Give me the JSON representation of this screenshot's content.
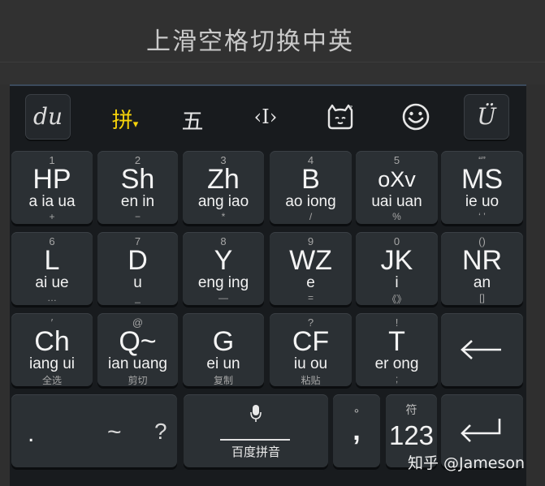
{
  "caption": {
    "title": "上滑空格切换中英"
  },
  "toolbar": {
    "left_logo": "du",
    "pinyin": "拼",
    "pinyin_arrow": "▾",
    "wubi": "五",
    "cursor": "‹I›",
    "cat": "🐱",
    "smile": "☺",
    "right_logo": "Ü"
  },
  "keys": {
    "k1": {
      "num": "1",
      "main": "HP",
      "sub": "a ia ua",
      "bot": "+"
    },
    "k2": {
      "num": "2",
      "main": "Sh",
      "sub": "en in",
      "bot": "−"
    },
    "k3": {
      "num": "3",
      "main": "Zh",
      "sub": "ang iao",
      "bot": "*"
    },
    "k4": {
      "num": "4",
      "main": "B",
      "sub": "ao iong",
      "bot": "/"
    },
    "k5": {
      "num": "5",
      "main": "oXv",
      "sub": "uai uan",
      "bot": "%"
    },
    "k6": {
      "num": "“”",
      "main": "MS",
      "sub": "ie uo",
      "bot": "‘ ’"
    },
    "k7": {
      "num": "6",
      "main": "L",
      "sub": "ai ue",
      "bot": "…"
    },
    "k8": {
      "num": "7",
      "main": "D",
      "sub": "u",
      "bot": "_"
    },
    "k9": {
      "num": "8",
      "main": "Y",
      "sub": "eng ing",
      "bot": "—"
    },
    "k10": {
      "num": "9",
      "main": "WZ",
      "sub": "e",
      "bot": "="
    },
    "k11": {
      "num": "0",
      "main": "JK",
      "sub": "i",
      "bot": "《》"
    },
    "k12": {
      "num": "()",
      "main": "NR",
      "sub": "an",
      "bot": "[]"
    },
    "k13": {
      "num": "′",
      "main": "Ch",
      "sub": "iang ui",
      "bot": "全选"
    },
    "k14": {
      "num": "@",
      "main": "Q~",
      "sub": "ian uang",
      "bot": "剪切"
    },
    "k15": {
      "num": "",
      "main": "G",
      "sub": "ei un",
      "bot": "复制"
    },
    "k16": {
      "num": "?",
      "main": "CF",
      "sub": "iu ou",
      "bot": "粘贴"
    },
    "k17": {
      "num": "!",
      "main": "T",
      "sub": "er ong",
      "bot": ";"
    }
  },
  "bottom": {
    "dot": ".",
    "tilde": "~",
    "question": "?",
    "mic_label": "百度拼音",
    "small_circle": "°",
    "comma": ",",
    "fu": "符",
    "num123": "123"
  },
  "watermark": "知乎 @Jameson"
}
